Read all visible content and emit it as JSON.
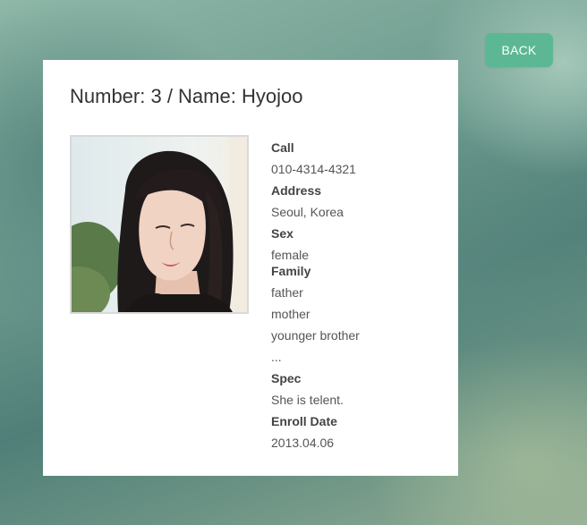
{
  "back_label": "BACK",
  "title": "Number: 3 / Name: Hyojoo",
  "photo": {
    "alt": "profile photo"
  },
  "info": {
    "call_label": "Call",
    "call_value": "010-4314-4321",
    "address_label": "Address",
    "address_value": "Seoul, Korea",
    "sex_label": "Sex",
    "sex_value": "female",
    "family_label": "Family",
    "family_members": [
      "father",
      "mother",
      "younger brother",
      "..."
    ],
    "spec_label": "Spec",
    "spec_value": "She is telent.",
    "enroll_label": "Enroll Date",
    "enroll_value": "2013.04.06"
  },
  "colors": {
    "accent": "#5cb894",
    "card": "#ffffff",
    "text": "#555555"
  }
}
